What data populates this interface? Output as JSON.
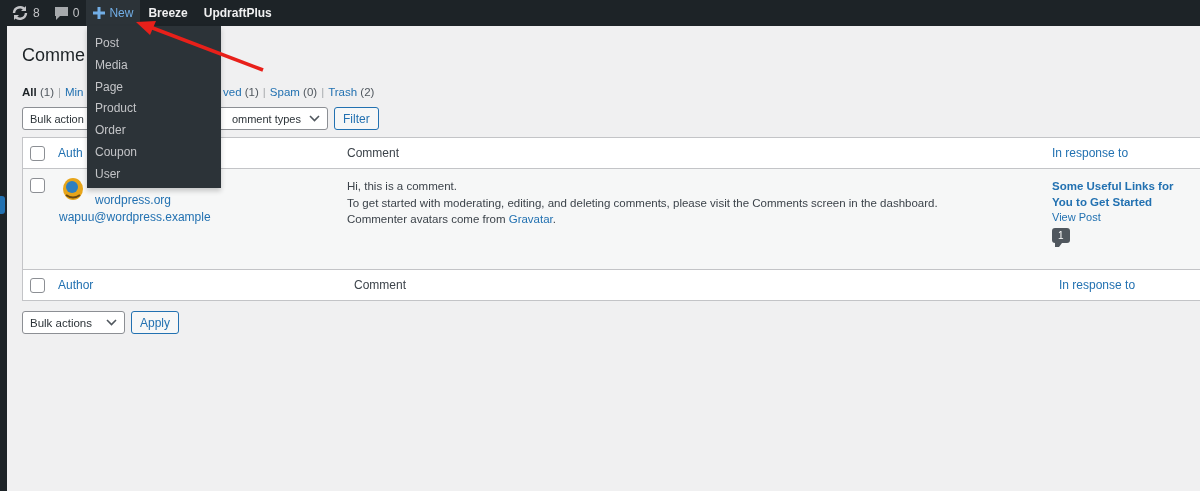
{
  "admin_bar": {
    "items": [
      {
        "kind": "updates",
        "label": "8"
      },
      {
        "kind": "comments",
        "label": "0"
      },
      {
        "kind": "new",
        "label": "New",
        "selected": true
      },
      {
        "kind": "text",
        "label": "Breeze",
        "selected": false
      },
      {
        "kind": "text",
        "label": "UpdraftPlus",
        "selected": false
      }
    ]
  },
  "new_menu": {
    "expanded": true,
    "items": [
      "Post",
      "Media",
      "Page",
      "Product",
      "Order",
      "Coupon",
      "User"
    ]
  },
  "page_title": "Comme",
  "status_links": {
    "separator": "|",
    "left": [
      {
        "label": "All",
        "count": "(1)",
        "selected": true
      },
      {
        "label": "Min",
        "selected": false
      }
    ],
    "right": [
      {
        "label": "ved",
        "count": "(1)",
        "selected": false
      },
      {
        "label": "Spam",
        "count": "(0)",
        "selected": false
      },
      {
        "label": "Trash",
        "count": "(2)",
        "selected": false
      }
    ]
  },
  "top_filters": {
    "bulk_select": "Bulk action",
    "type_select": "omment types",
    "filter_button": "Filter"
  },
  "table": {
    "header_checked": false,
    "footer_checked": false,
    "header": [
      "Auth",
      "Comment",
      "In response to"
    ],
    "footer": [
      "Author",
      "Comment",
      "In response to"
    ],
    "rows": [
      {
        "checked": false,
        "author_site": "wordpress.org",
        "author_email": "wapuu@wordpress.example",
        "comment_lines": [
          "Hi, this is a comment.",
          "To get started with moderating, editing, and deleting comments, please visit the Comments screen in the dashboard."
        ],
        "comment_last": {
          "before": "Commenter avatars come from ",
          "link": "Gravatar",
          "after": "."
        },
        "response": {
          "title": "Some Useful Links for You to Get Started",
          "view": "View Post",
          "count": "1"
        }
      }
    ]
  },
  "bottom_actions": {
    "bulk_select": "Bulk actions",
    "apply_button": "Apply"
  }
}
